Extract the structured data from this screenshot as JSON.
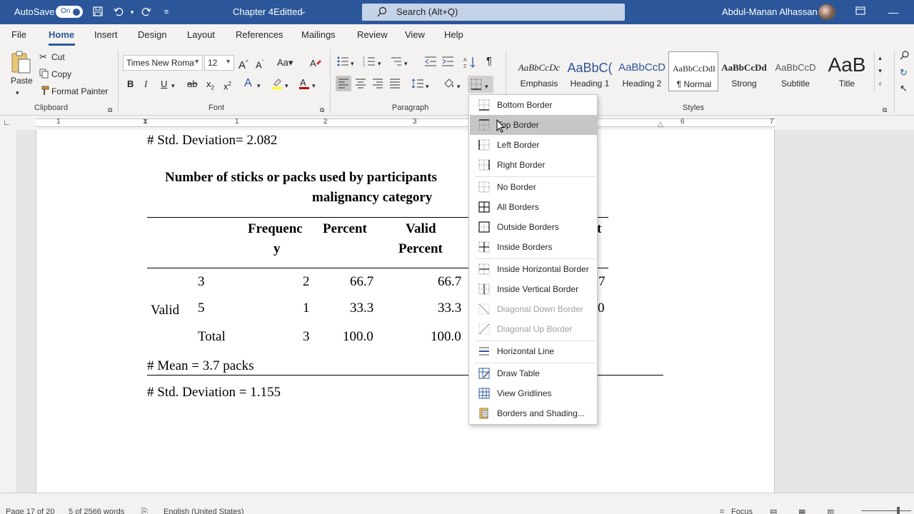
{
  "titlebar": {
    "autosave_label": "AutoSave",
    "autosave_state": "On",
    "doc_title": "Chapter 4Editted",
    "search_placeholder": "Search (Alt+Q)",
    "user_name": "Abdul-Manan Alhassan"
  },
  "tabs": [
    "File",
    "Home",
    "Insert",
    "Design",
    "Layout",
    "References",
    "Mailings",
    "Review",
    "View",
    "Help"
  ],
  "ribbon": {
    "clipboard": {
      "paste": "Paste",
      "cut": "Cut",
      "copy": "Copy",
      "format_painter": "Format Painter",
      "label": "Clipboard"
    },
    "font": {
      "font_name": "Times New Roma",
      "font_size": "12",
      "label": "Font"
    },
    "paragraph": {
      "label": "Paragraph"
    },
    "styles": {
      "label": "Styles",
      "items": [
        {
          "sample": "AaBbCcDc",
          "name": "Emphasis"
        },
        {
          "sample": "AaBbC(",
          "name": "Heading 1"
        },
        {
          "sample": "AaBbCcD",
          "name": "Heading 2"
        },
        {
          "sample": "AaBbCcDdI",
          "name": "¶ Normal"
        },
        {
          "sample": "AaBbCcDd",
          "name": "Strong"
        },
        {
          "sample": "AaBbCcD",
          "name": "Subtitle"
        },
        {
          "sample": "AaB",
          "name": "Title"
        }
      ]
    }
  },
  "ruler": {
    "numbers": [
      "1",
      "1",
      "2",
      "3",
      "6",
      "7"
    ]
  },
  "document": {
    "line1": "# Std. Deviation= 2.082",
    "table_title_1": "Number of sticks or packs used by participants",
    "table_title_2": "malignancy category",
    "headers": {
      "freq_1": "Frequenc",
      "freq_2": "y",
      "percent": "Percent",
      "valid_1": "Valid",
      "valid_2": "Percent",
      "cum_partial": "t"
    },
    "valid_label": "Valid",
    "rows": [
      {
        "label": "3",
        "freq": "2",
        "percent": "66.7",
        "valid": "66.7",
        "cum": "7"
      },
      {
        "label": "5",
        "freq": "1",
        "percent": "33.3",
        "valid": "33.3",
        "cum": "0"
      },
      {
        "label": "Total",
        "freq": "3",
        "percent": "100.0",
        "valid": "100.0",
        "cum": ""
      }
    ],
    "mean": "# Mean = 3.7 packs",
    "std": "# Std. Deviation = 1.155"
  },
  "border_menu": {
    "items": [
      {
        "label": "Bottom Border",
        "icon": "bottom-border-icon"
      },
      {
        "label": "Top Border",
        "icon": "top-border-icon"
      },
      {
        "label": "Left Border",
        "icon": "left-border-icon"
      },
      {
        "label": "Right Border",
        "icon": "right-border-icon"
      },
      {
        "label": "No Border",
        "icon": "no-border-icon"
      },
      {
        "label": "All Borders",
        "icon": "all-borders-icon"
      },
      {
        "label": "Outside Borders",
        "icon": "outside-borders-icon"
      },
      {
        "label": "Inside Borders",
        "icon": "inside-borders-icon"
      },
      {
        "label": "Inside Horizontal Border",
        "icon": "inside-horizontal-border-icon"
      },
      {
        "label": "Inside Vertical Border",
        "icon": "inside-vertical-border-icon"
      },
      {
        "label": "Diagonal Down Border",
        "icon": "diagonal-down-border-icon"
      },
      {
        "label": "Diagonal Up Border",
        "icon": "diagonal-up-border-icon"
      },
      {
        "label": "Horizontal Line",
        "icon": "horizontal-line-icon"
      },
      {
        "label": "Draw Table",
        "icon": "draw-table-icon"
      },
      {
        "label": "View Gridlines",
        "icon": "view-gridlines-icon"
      },
      {
        "label": "Borders and Shading...",
        "icon": "borders-shading-icon"
      }
    ]
  },
  "statusbar": {
    "page": "Page 17 of 20",
    "words": "5 of 2566 words",
    "language": "English (United States)",
    "focus": "Focus"
  },
  "colors": {
    "brand": "#2b579a",
    "highlight": "#ffff00",
    "font_color": "#c00000"
  }
}
